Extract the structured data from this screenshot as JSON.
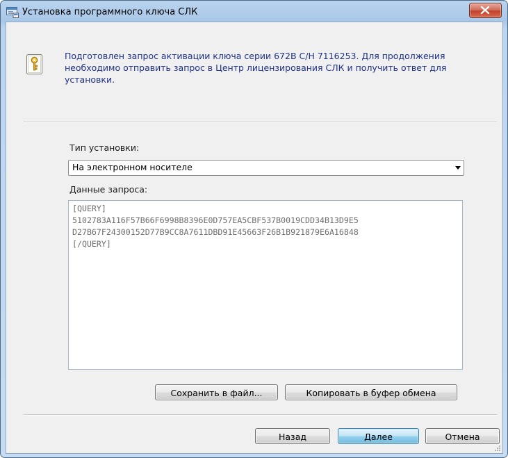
{
  "window": {
    "title": "Установка программного ключа СЛК"
  },
  "message": {
    "text": "Подготовлен запрос активации ключа серии 672В С/Н 7116253. Для продолжения необходимо отправить запрос в Центр лицензирования СЛК и получить ответ для установки."
  },
  "install_type": {
    "label": "Тип установки:",
    "selected": "На электронном носителе"
  },
  "request_data": {
    "label": "Данные запроса:",
    "text": "[QUERY]\n5102783A116F57B66F6998B8396E0D757EA5CBF537B0019CDD34B13D9E5\nD27B67F24300152D77B9CC8A7611DBD91E45663F26B1B921879E6A16848\n[/QUERY]"
  },
  "buttons": {
    "save_file": "Сохранить в файл...",
    "copy_clipboard": "Копировать в буфер обмена",
    "back": "Назад",
    "next": "Далее",
    "cancel": "Отмена"
  },
  "colors": {
    "message_text": "#1e3287",
    "title_bar": "#b9d3ee",
    "dialog_bg": "#f0f0f0",
    "close_button": "#c2412b"
  },
  "icons": {
    "title": "app-window-icon",
    "close": "close-icon",
    "info": "key-info-icon",
    "dropdown": "chevron-down-icon"
  }
}
